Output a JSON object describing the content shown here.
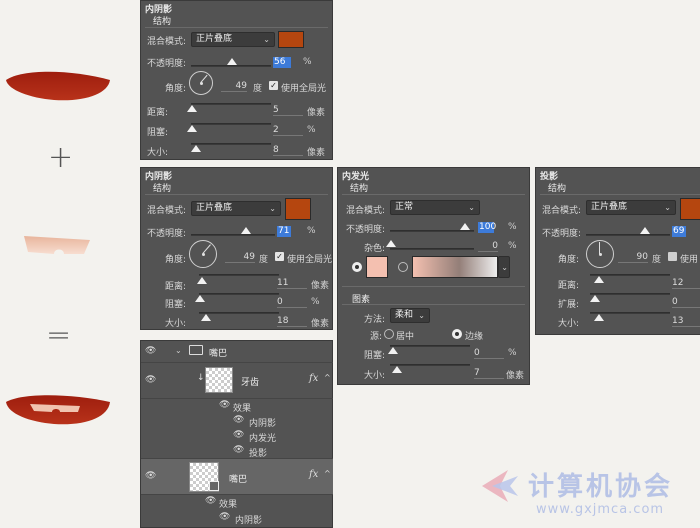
{
  "op_plus": "+",
  "op_equals": "=",
  "colors": {
    "panel_bg": "#535353",
    "swatch_orange": "#b5460f",
    "swatch_pink": "#f4c0b0",
    "select_blue": "#3d7bd9"
  },
  "panel1": {
    "title": "内阴影",
    "subtitle": "结构",
    "blend_label": "混合模式:",
    "blend_value": "正片叠底",
    "opacity_label": "不透明度:",
    "opacity_value": "56",
    "opacity_unit": "%",
    "angle_label": "角度:",
    "angle_value": "49",
    "angle_unit": "度",
    "global_light": "使用全局光",
    "distance_label": "距离:",
    "distance_value": "5",
    "distance_unit": "像素",
    "choke_label": "阻塞:",
    "choke_value": "2",
    "choke_unit": "%",
    "size_label": "大小:",
    "size_value": "8",
    "size_unit": "像素"
  },
  "panel2": {
    "title": "内阴影",
    "subtitle": "结构",
    "blend_label": "混合模式:",
    "blend_value": "正片叠底",
    "opacity_label": "不透明度:",
    "opacity_value": "71",
    "opacity_unit": "%",
    "angle_label": "角度:",
    "angle_value": "49",
    "angle_unit": "度",
    "global_light": "使用全局光",
    "distance_label": "距离:",
    "distance_value": "11",
    "distance_unit": "像素",
    "choke_label": "阻塞:",
    "choke_value": "0",
    "choke_unit": "%",
    "size_label": "大小:",
    "size_value": "18",
    "size_unit": "像素"
  },
  "panel3": {
    "title": "内发光",
    "subtitle": "结构",
    "blend_label": "混合模式:",
    "blend_value": "正常",
    "opacity_label": "不透明度:",
    "opacity_value": "100",
    "opacity_unit": "%",
    "noise_label": "杂色:",
    "noise_value": "0",
    "noise_unit": "%",
    "elements_title": "图素",
    "method_label": "方法:",
    "method_value": "柔和",
    "source_label": "源:",
    "source_center": "居中",
    "source_edge": "边缘",
    "choke_label": "阻塞:",
    "choke_value": "0",
    "choke_unit": "%",
    "size_label": "大小:",
    "size_value": "7",
    "size_unit": "像素"
  },
  "panel4": {
    "title": "投影",
    "subtitle": "结构",
    "blend_label": "混合模式:",
    "blend_value": "正片叠底",
    "opacity_label": "不透明度:",
    "opacity_value": "69",
    "angle_label": "角度:",
    "angle_value": "90",
    "angle_unit": "度",
    "global_light": "使用",
    "distance_label": "距离:",
    "distance_value": "12",
    "spread_label": "扩展:",
    "spread_value": "0",
    "size_label": "大小:",
    "size_value": "13"
  },
  "layers": {
    "group_name": "嘴巴",
    "teeth_name": "牙齿",
    "mouth_name": "嘴巴",
    "effects": "效果",
    "inner_shadow": "内阴影",
    "inner_glow": "内发光",
    "drop_shadow": "投影",
    "fx": "fx"
  },
  "watermark": {
    "title": "计算机协会",
    "url": "www.gxjmca.com"
  }
}
